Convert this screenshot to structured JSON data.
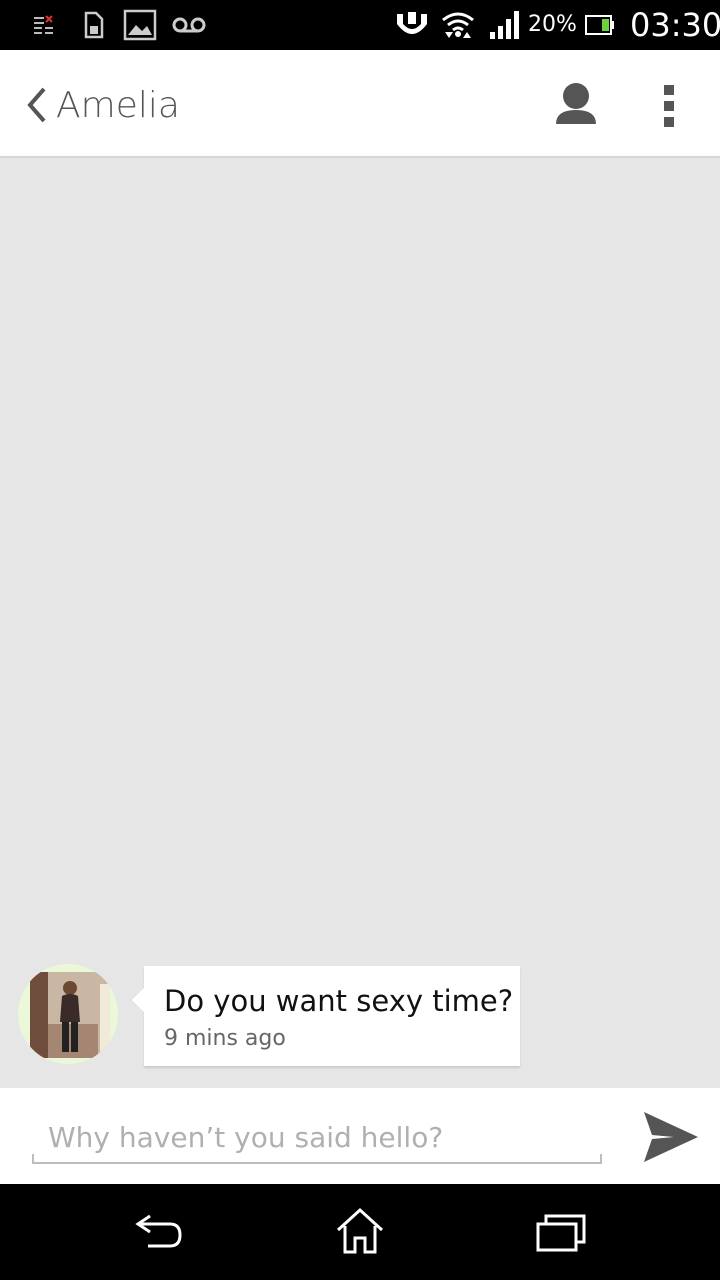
{
  "status_bar": {
    "battery_percent": "20%",
    "clock": "03:30",
    "icons": [
      "notification-list-icon",
      "sim-card-icon",
      "gallery-icon",
      "voicemail-icon",
      "stamina-mode-icon",
      "wifi-icon",
      "signal-icon",
      "battery-icon"
    ]
  },
  "app_bar": {
    "contact_name": "Amelia",
    "icons": [
      "back-chevron-icon",
      "profile-icon",
      "overflow-menu-icon"
    ]
  },
  "chat": {
    "messages": [
      {
        "text": "Do you want sexy time?",
        "time": "9 mins ago"
      }
    ]
  },
  "compose": {
    "placeholder": "Why haven’t you said hello?",
    "value": ""
  },
  "nav_bar": {
    "icons": [
      "back-icon",
      "home-icon",
      "recent-apps-icon"
    ]
  },
  "colors": {
    "chat_background": "#e6e6e6",
    "app_bar": "#ffffff",
    "accent_icon": "#555555"
  }
}
